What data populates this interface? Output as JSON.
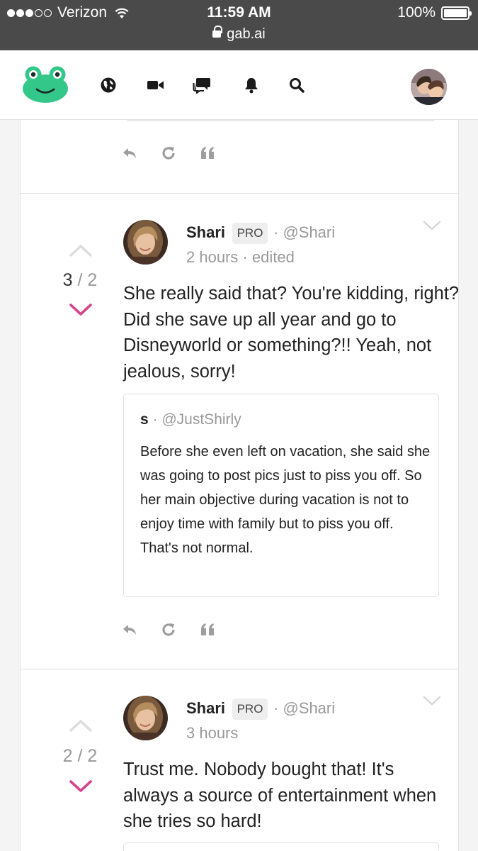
{
  "status_bar": {
    "carrier": "Verizon",
    "time": "11:59 AM",
    "url": "gab.ai",
    "battery": "100%"
  },
  "nav": {
    "icons": [
      "frog-logo-icon",
      "globe-icon",
      "video-icon",
      "chat-icon",
      "bell-icon",
      "search-icon",
      "avatar"
    ]
  },
  "posts": [
    {
      "score": "3",
      "score_sep": "/",
      "score_total": "2",
      "author": "Shari",
      "badge": "PRO",
      "handle": "· @Shari",
      "time": "2 hours · edited",
      "body": "She really said that? You're kidding, right? Did she save up all year and go to Disneyworld or something?!! Yeah, not jealous, sorry!",
      "quote": {
        "author": "s",
        "handle": " · @JustShirly",
        "body": "Before she even left on vacation, she said she was going to post pics just to piss you off. So her main objective during vacation is not to enjoy time with family but to piss you off. That's not normal."
      }
    },
    {
      "score": "2",
      "score_sep": "/",
      "score_total": "2",
      "author": "Shari",
      "badge": "PRO",
      "handle": "· @Shari",
      "time": "3 hours",
      "body": "Trust me. Nobody bought that! It's always a source of entertainment when she tries so hard!"
    }
  ],
  "colors": {
    "status_bar_bg": "#4a4a4a",
    "logo_green": "#33c88a",
    "downvote_pink": "#d6458a",
    "muted_gray": "#999999"
  }
}
